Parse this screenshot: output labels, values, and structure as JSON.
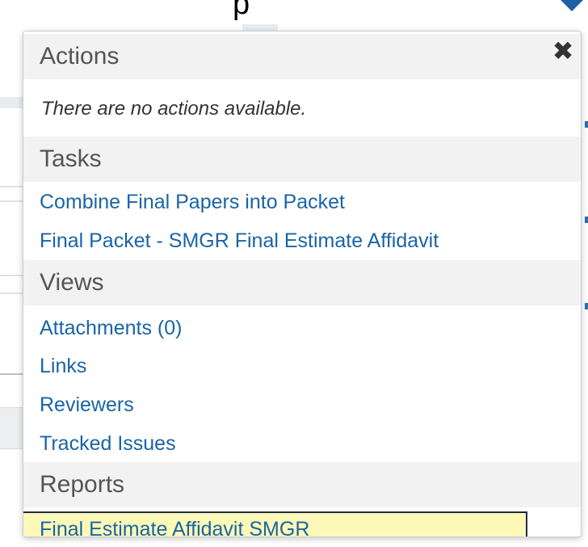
{
  "background": {
    "glyph": "p"
  },
  "panel": {
    "close_icon": "✖",
    "sections": {
      "actions": {
        "title": "Actions",
        "empty_message": "There are no actions available."
      },
      "tasks": {
        "title": "Tasks",
        "items": [
          "Combine Final Papers into Packet",
          "Final Packet - SMGR Final Estimate Affidavit"
        ]
      },
      "views": {
        "title": "Views",
        "items": [
          "Attachments (0)",
          "Links",
          "Reviewers",
          "Tracked Issues"
        ]
      },
      "reports": {
        "title": "Reports",
        "items": [
          "Final Estimate Affidavit SMGR"
        ]
      }
    }
  },
  "colors": {
    "link": "#1a64a6",
    "header_bg": "#f2f2f2",
    "header_text": "#555555",
    "highlight_bg": "#fcf9b8",
    "accent_arrow": "#1f5fa3"
  }
}
